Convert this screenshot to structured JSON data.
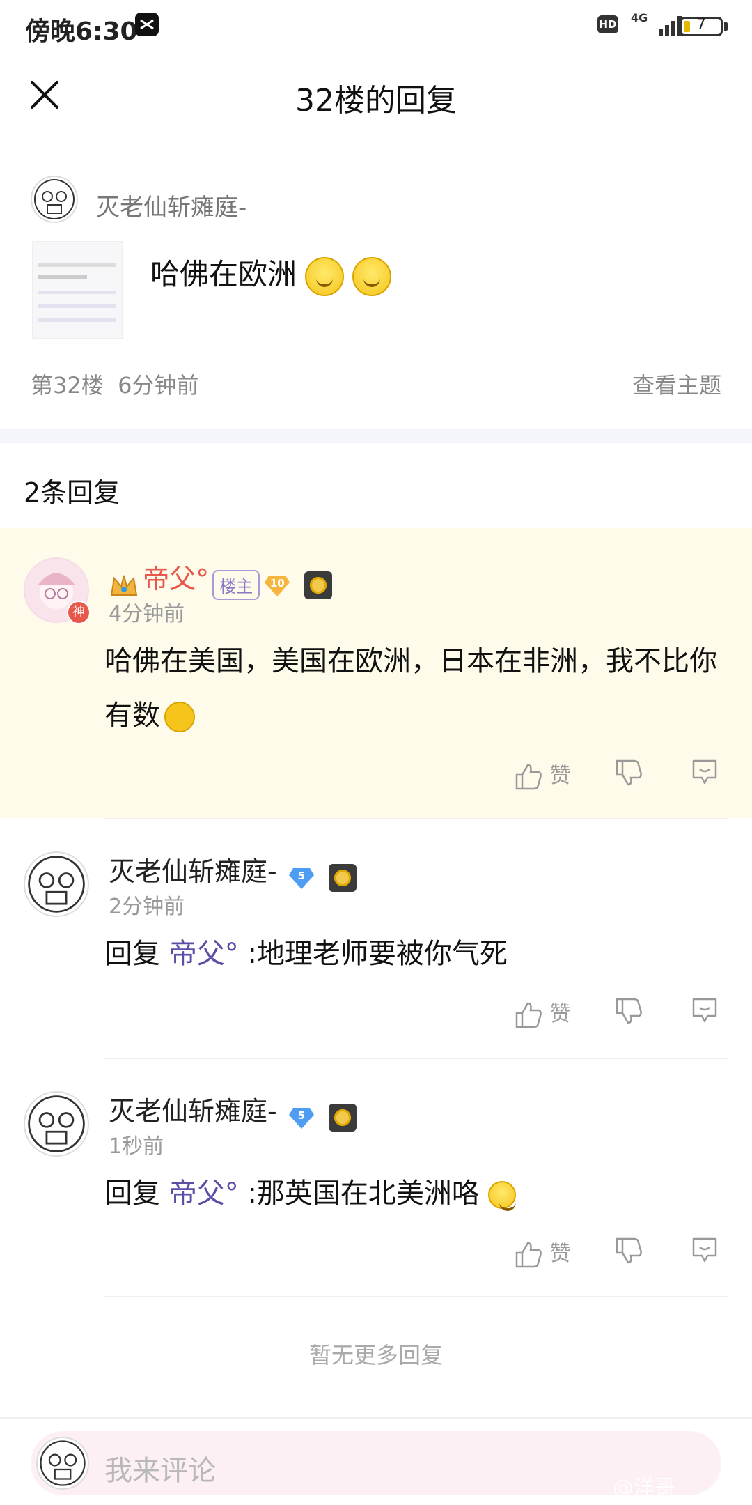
{
  "status_bar": {
    "time": "傍晚6:30",
    "hd_label": "HD",
    "network": "4G",
    "battery": "7"
  },
  "header": {
    "title": "32楼的回复"
  },
  "post": {
    "author": "灭老仙斩瘫庭-",
    "text": "哈佛在欧洲",
    "floor": "第32楼",
    "time": "6分钟前",
    "view_topic": "查看主题"
  },
  "reply_section": {
    "count_label": "2条回复"
  },
  "replies": [
    {
      "author": "帝父°",
      "author_color": "#e8584a",
      "badge": "楼主",
      "level": "10",
      "time": "4分钟前",
      "avatar_badge": "神",
      "text": "哈佛在美国，美国在欧洲，日本在非洲，我不比你有数",
      "like_label": "赞"
    },
    {
      "author": "灭老仙斩瘫庭-",
      "level": "5",
      "time": "2分钟前",
      "reply_prefix": "回复",
      "reply_to": "帝父°",
      "text": ":地理老师要被你气死",
      "like_label": "赞"
    },
    {
      "author": "灭老仙斩瘫庭-",
      "level": "5",
      "time": "1秒前",
      "reply_prefix": "回复",
      "reply_to": "帝父°",
      "text": ":那英国在北美洲咯",
      "like_label": "赞"
    }
  ],
  "footer": {
    "no_more": "暂无更多回复",
    "comment_placeholder": "我来评论",
    "watermark": "@洋哥"
  }
}
